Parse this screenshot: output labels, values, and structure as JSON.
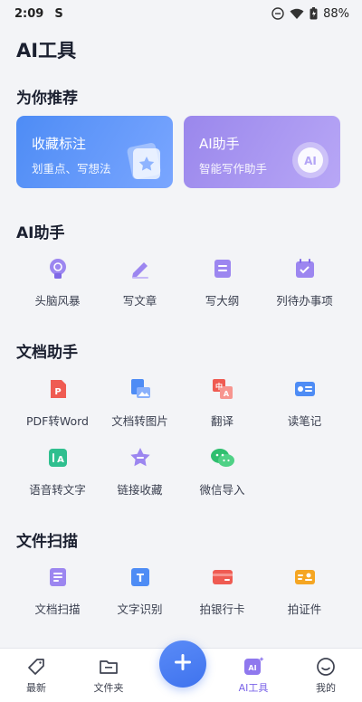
{
  "status": {
    "time": "2:09",
    "app_glyph": "S",
    "battery": "88%"
  },
  "page_title": "AI工具",
  "recommend": {
    "title": "为你推荐",
    "cards": [
      {
        "title": "收藏标注",
        "subtitle": "划重点、写想法",
        "icon": "star-icon",
        "color": "#5b93f6"
      },
      {
        "title": "AI助手",
        "subtitle": "智能写作助手",
        "icon": "ai-badge-icon",
        "color": "#a08eee"
      }
    ]
  },
  "ai_assistant": {
    "title": "AI助手",
    "items": [
      {
        "label": "头脑风暴",
        "icon": "brain-icon"
      },
      {
        "label": "写文章",
        "icon": "pen-icon"
      },
      {
        "label": "写大纲",
        "icon": "outline-icon"
      },
      {
        "label": "列待办事项",
        "icon": "calendar-check-icon"
      }
    ]
  },
  "doc_assistant": {
    "title": "文档助手",
    "items": [
      {
        "label": "PDF转Word",
        "icon": "pdf-icon"
      },
      {
        "label": "文档转图片",
        "icon": "doc-image-icon"
      },
      {
        "label": "翻译",
        "icon": "translate-icon"
      },
      {
        "label": "读笔记",
        "icon": "read-notes-icon"
      },
      {
        "label": "语音转文字",
        "icon": "voice-text-icon"
      },
      {
        "label": "链接收藏",
        "icon": "link-star-icon"
      },
      {
        "label": "微信导入",
        "icon": "wechat-icon"
      }
    ],
    "translate_glyphs": {
      "zh": "中",
      "en": "A"
    },
    "voice_glyph": "A",
    "pdf_glyph": "P"
  },
  "file_scan": {
    "title": "文件扫描",
    "items": [
      {
        "label": "文档扫描",
        "icon": "doc-scan-icon"
      },
      {
        "label": "文字识别",
        "icon": "text-recognize-icon"
      },
      {
        "label": "拍银行卡",
        "icon": "bank-card-icon"
      },
      {
        "label": "拍证件",
        "icon": "id-card-icon"
      }
    ],
    "ocr_glyph": "T"
  },
  "tabbar": {
    "tabs": [
      {
        "label": "最新",
        "icon": "tag-icon"
      },
      {
        "label": "文件夹",
        "icon": "folder-icon"
      },
      {
        "label": "AI工具",
        "icon": "ai-tools-icon",
        "active": true
      },
      {
        "label": "我的",
        "icon": "smiley-icon"
      }
    ],
    "ai_glyph": "AI",
    "active_color": "#7b64e8"
  }
}
